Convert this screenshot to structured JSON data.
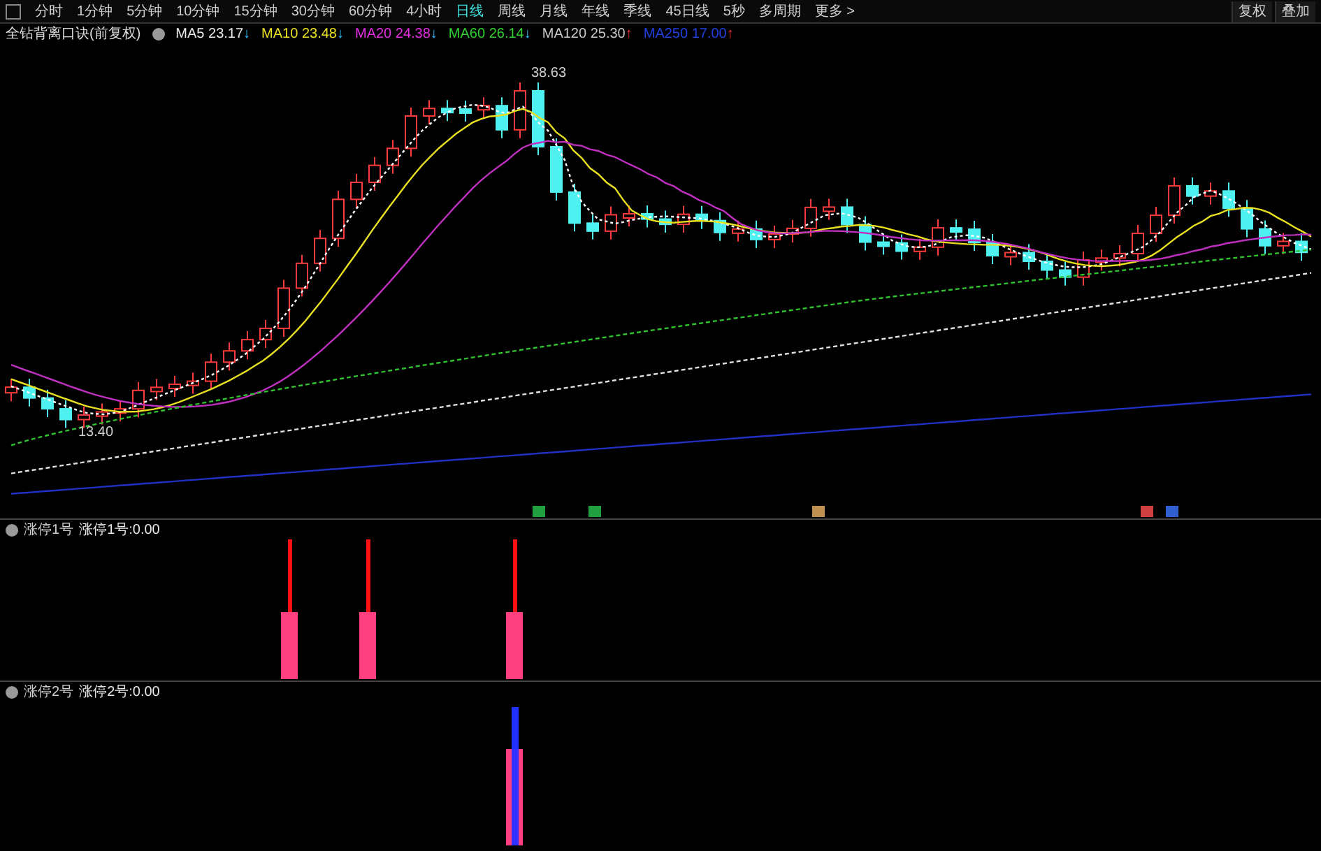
{
  "toolbar": {
    "tabs": [
      {
        "label": "分时",
        "selected": false
      },
      {
        "label": "1分钟",
        "selected": false
      },
      {
        "label": "5分钟",
        "selected": false
      },
      {
        "label": "10分钟",
        "selected": false
      },
      {
        "label": "15分钟",
        "selected": false
      },
      {
        "label": "30分钟",
        "selected": false
      },
      {
        "label": "60分钟",
        "selected": false
      },
      {
        "label": "4小时",
        "selected": false
      },
      {
        "label": "日线",
        "selected": true
      },
      {
        "label": "周线",
        "selected": false
      },
      {
        "label": "月线",
        "selected": false
      },
      {
        "label": "年线",
        "selected": false
      },
      {
        "label": "季线",
        "selected": false
      },
      {
        "label": "45日线",
        "selected": false
      },
      {
        "label": "5秒",
        "selected": false
      },
      {
        "label": "多周期",
        "selected": false
      },
      {
        "label": "更多 >",
        "selected": false
      }
    ],
    "right_buttons": [
      "复权",
      "叠加"
    ]
  },
  "legend": {
    "title": "全钻背离口诀(前复权)",
    "indicators": [
      {
        "name": "MA5",
        "value": "23.17",
        "arrow": "↓",
        "color": "#e8e8e8"
      },
      {
        "name": "MA10",
        "value": "23.48",
        "arrow": "↓",
        "color": "#e8e020"
      },
      {
        "name": "MA20",
        "value": "24.38",
        "arrow": "↓",
        "color": "#e030e0"
      },
      {
        "name": "MA60",
        "value": "26.14",
        "arrow": "↓",
        "color": "#30d030"
      },
      {
        "name": "MA120",
        "value": "25.30",
        "arrow": "↑",
        "color": "#c8c8c8"
      },
      {
        "name": "MA250",
        "value": "17.00",
        "arrow": "↑",
        "color": "#2040e0"
      }
    ]
  },
  "price_labels": {
    "high": "38.63",
    "low": "13.40"
  },
  "panels": [
    {
      "title": "涨停1号",
      "reading": "涨停1号:0.00"
    },
    {
      "title": "涨停2号",
      "reading": "涨停2号:0.00"
    }
  ]
}
